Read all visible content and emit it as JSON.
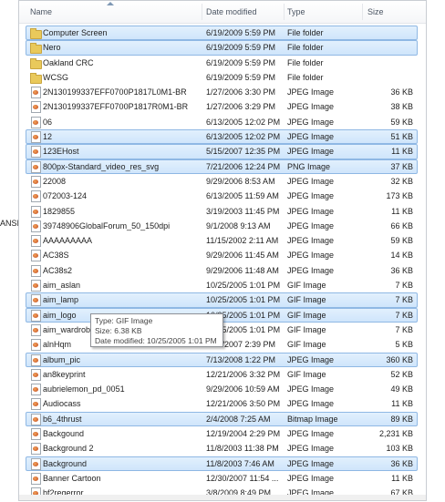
{
  "left_cut_text": "ANSI",
  "columns": {
    "name": "Name",
    "date": "Date modified",
    "type": "Type",
    "size": "Size"
  },
  "rows": [
    {
      "name": "Computer Screen",
      "date": "6/19/2009 5:59 PM",
      "type": "File folder",
      "size": "",
      "icon": "folder-icon",
      "selected": true
    },
    {
      "name": "Nero",
      "date": "6/19/2009 5:59 PM",
      "type": "File folder",
      "size": "",
      "icon": "folder-icon",
      "selected": true
    },
    {
      "name": "Oakland CRC",
      "date": "6/19/2009 5:59 PM",
      "type": "File folder",
      "size": "",
      "icon": "folder-icon",
      "selected": false
    },
    {
      "name": "WCSG",
      "date": "6/19/2009 5:59 PM",
      "type": "File folder",
      "size": "",
      "icon": "folder-icon",
      "selected": false
    },
    {
      "name": "2N130199337EFF0700P1817L0M1-BR",
      "date": "1/27/2006 3:30 PM",
      "type": "JPEG Image",
      "size": "36 KB",
      "icon": "image-icon",
      "selected": false
    },
    {
      "name": "2N130199337EFF0700P1817R0M1-BR",
      "date": "1/27/2006 3:29 PM",
      "type": "JPEG Image",
      "size": "38 KB",
      "icon": "image-icon",
      "selected": false
    },
    {
      "name": "06",
      "date": "6/13/2005 12:02 PM",
      "type": "JPEG Image",
      "size": "59 KB",
      "icon": "image-icon",
      "selected": false
    },
    {
      "name": "12",
      "date": "6/13/2005 12:02 PM",
      "type": "JPEG Image",
      "size": "51 KB",
      "icon": "image-icon",
      "selected": true
    },
    {
      "name": "123EHost",
      "date": "5/15/2007 12:35 PM",
      "type": "JPEG Image",
      "size": "11 KB",
      "icon": "image-icon",
      "selected": true
    },
    {
      "name": "800px-Standard_video_res_svg",
      "date": "7/21/2006 12:24 PM",
      "type": "PNG Image",
      "size": "37 KB",
      "icon": "image-icon",
      "selected": true
    },
    {
      "name": "22008",
      "date": "9/29/2006 8:53 AM",
      "type": "JPEG Image",
      "size": "32 KB",
      "icon": "image-icon",
      "selected": false
    },
    {
      "name": "072003-124",
      "date": "6/13/2005 11:59 AM",
      "type": "JPEG Image",
      "size": "173 KB",
      "icon": "image-icon",
      "selected": false
    },
    {
      "name": "1829855",
      "date": "3/19/2003 11:45 PM",
      "type": "JPEG Image",
      "size": "11 KB",
      "icon": "image-icon",
      "selected": false
    },
    {
      "name": "39748906GlobalForum_50_150dpi",
      "date": "9/1/2008 9:13 AM",
      "type": "JPEG Image",
      "size": "66 KB",
      "icon": "image-icon",
      "selected": false
    },
    {
      "name": "AAAAAAAAA",
      "date": "11/15/2002 2:11 AM",
      "type": "JPEG Image",
      "size": "59 KB",
      "icon": "image-icon",
      "selected": false
    },
    {
      "name": "AC38S",
      "date": "9/29/2006 11:45 AM",
      "type": "JPEG Image",
      "size": "14 KB",
      "icon": "image-icon",
      "selected": false
    },
    {
      "name": "AC38s2",
      "date": "9/29/2006 11:48 AM",
      "type": "JPEG Image",
      "size": "36 KB",
      "icon": "image-icon",
      "selected": false
    },
    {
      "name": "aim_aslan",
      "date": "10/25/2005 1:01 PM",
      "type": "GIF Image",
      "size": "7 KB",
      "icon": "image-icon",
      "selected": false
    },
    {
      "name": "aim_lamp",
      "date": "10/25/2005 1:01 PM",
      "type": "GIF Image",
      "size": "7 KB",
      "icon": "image-icon",
      "selected": true
    },
    {
      "name": "aim_logo",
      "date": "10/25/2005 1:01 PM",
      "type": "GIF Image",
      "size": "7 KB",
      "icon": "image-icon",
      "selected": true
    },
    {
      "name": "aim_wardrob",
      "date": "10/25/2005 1:01 PM",
      "type": "GIF Image",
      "size": "7 KB",
      "icon": "image-icon",
      "selected": false
    },
    {
      "name": "alnHqm",
      "date": "6/20/2007 2:39 PM",
      "type": "GIF Image",
      "size": "5 KB",
      "icon": "image-icon",
      "selected": false
    },
    {
      "name": "album_pic",
      "date": "7/13/2008 1:22 PM",
      "type": "JPEG Image",
      "size": "360 KB",
      "icon": "image-icon",
      "selected": true
    },
    {
      "name": "an8keyprint",
      "date": "12/21/2006 3:32 PM",
      "type": "GIF Image",
      "size": "52 KB",
      "icon": "image-icon",
      "selected": false
    },
    {
      "name": "aubrielemon_pd_0051",
      "date": "9/29/2006 10:59 AM",
      "type": "JPEG Image",
      "size": "49 KB",
      "icon": "image-icon",
      "selected": false
    },
    {
      "name": "Audiocass",
      "date": "12/21/2006 3:50 PM",
      "type": "JPEG Image",
      "size": "11 KB",
      "icon": "image-icon",
      "selected": false
    },
    {
      "name": "b6_4thrust",
      "date": "2/4/2008 7:25 AM",
      "type": "Bitmap Image",
      "size": "89 KB",
      "icon": "image-icon",
      "selected": true
    },
    {
      "name": "Backgound",
      "date": "12/19/2004 2:29 PM",
      "type": "JPEG Image",
      "size": "2,231 KB",
      "icon": "image-icon",
      "selected": false
    },
    {
      "name": "Background 2",
      "date": "11/8/2003 11:38 PM",
      "type": "JPEG Image",
      "size": "103 KB",
      "icon": "image-icon",
      "selected": false
    },
    {
      "name": "Background",
      "date": "11/8/2003 7:46 AM",
      "type": "JPEG Image",
      "size": "36 KB",
      "icon": "image-icon",
      "selected": true
    },
    {
      "name": "Banner Cartoon",
      "date": "12/30/2007 11:54 ...",
      "type": "JPEG Image",
      "size": "11 KB",
      "icon": "image-icon",
      "selected": false
    },
    {
      "name": "bf2regerror",
      "date": "3/8/2009 8:49 PM",
      "type": "JPEG Image",
      "size": "67 KB",
      "icon": "image-icon",
      "selected": false
    }
  ],
  "tooltip": {
    "type": "Type: GIF Image",
    "size": "Size: 6.38 KB",
    "date": "Date modified: 10/25/2005 1:01 PM"
  }
}
